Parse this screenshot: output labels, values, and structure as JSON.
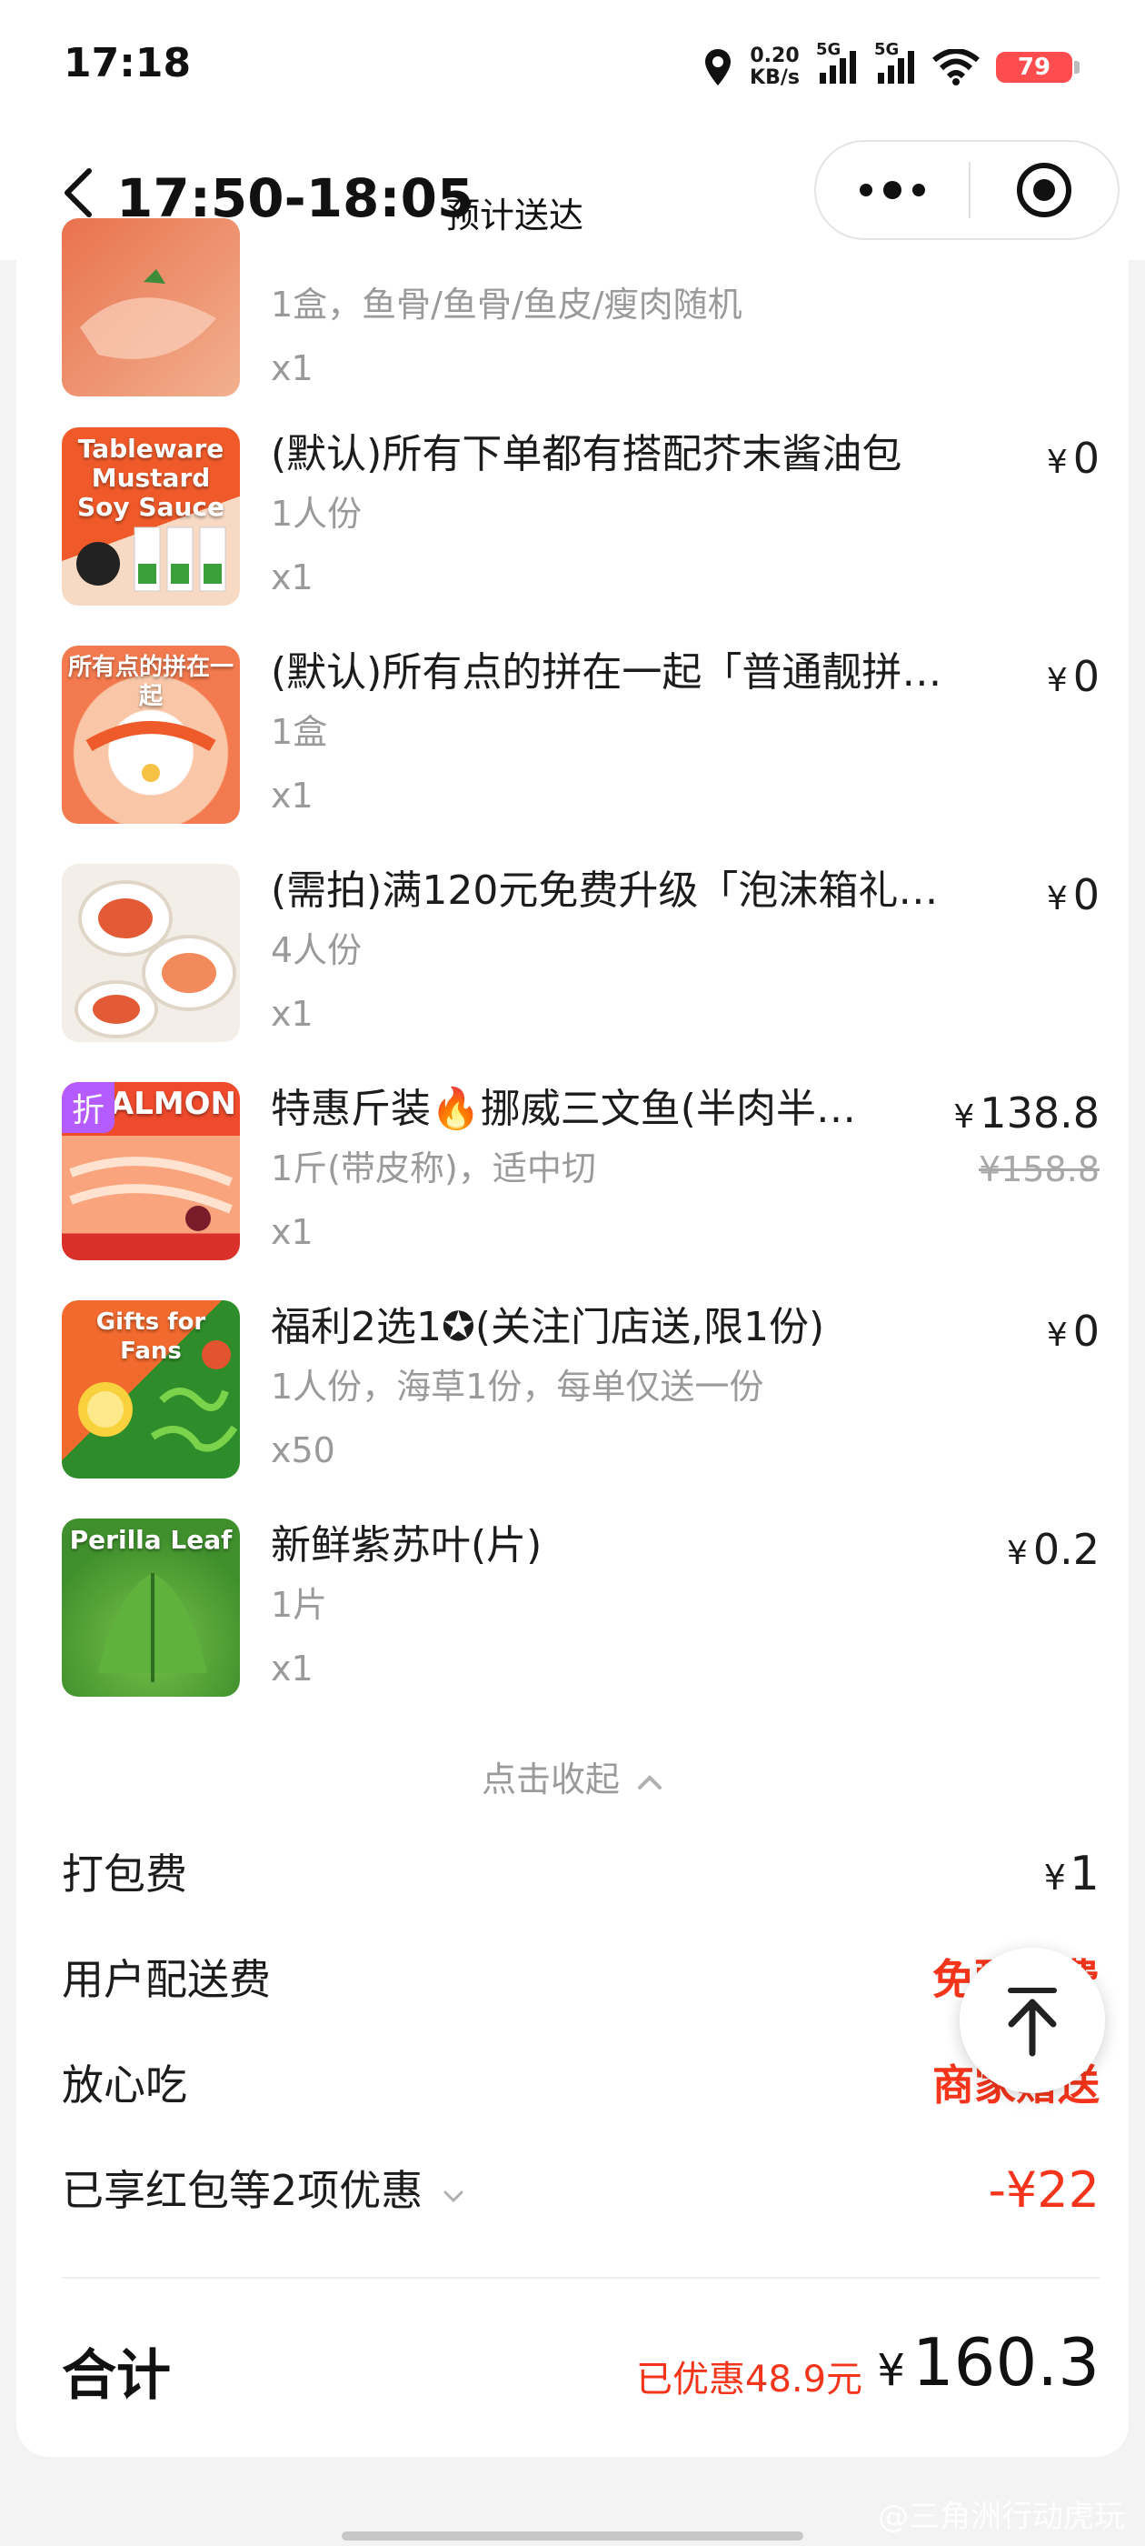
{
  "status_bar": {
    "time": "17:18",
    "net_speed_value": "0.20",
    "net_speed_unit": "KB/s",
    "signal_1": "5G",
    "signal_2": "5G",
    "battery": "79"
  },
  "header": {
    "delivery_time": "17:50-18:05",
    "delivery_label": "预计送达"
  },
  "items": [
    {
      "name": "",
      "spec": "1盒，鱼骨/鱼骨/鱼皮/瘦肉随机",
      "qty": "x1",
      "price": "",
      "image_colors": [
        "#e9724d",
        "#f2b08f"
      ]
    },
    {
      "name": "(默认)所有下单都有搭配芥末酱油包",
      "spec": "1人份",
      "qty": "x1",
      "price": "0",
      "image_text": "Tableware Mustard Soy Sauce",
      "image_colors": [
        "#f05a2a",
        "#f7d9c4"
      ]
    },
    {
      "name": "(默认)所有点的拼在一起「普通靓拼…",
      "spec": "1盒",
      "qty": "x1",
      "price": "0",
      "image_text": "所有点的拼在一起",
      "image_colors": [
        "#f37a4e",
        "#f9c7a8"
      ]
    },
    {
      "name": "(需拍)满120元免费升级「泡沫箱礼…",
      "spec": "4人份",
      "qty": "x1",
      "price": "0",
      "image_colors": [
        "#f3efe8",
        "#e25a36"
      ]
    },
    {
      "name": "特惠斤装🔥挪威三文鱼(半肉半…",
      "spec": "1斤(带皮称)，适中切",
      "qty": "x1",
      "price": "138.8",
      "original_price": "¥158.8",
      "discount_tag": "折",
      "image_text": "ALMON",
      "image_colors": [
        "#ef4a2c",
        "#f9a47c"
      ]
    },
    {
      "name": "福利2选1✪(关注门店送,限1份)",
      "spec": "1人份，海草1份，每单仅送一份",
      "qty": "x50",
      "price": "0",
      "image_text": "Gifts for Fans",
      "image_colors": [
        "#f26a2e",
        "#2f8c2a"
      ]
    },
    {
      "name": "新鲜紫苏叶(片)",
      "spec": "1片",
      "qty": "x1",
      "price": "0.2",
      "image_text": "Perilla Leaf",
      "image_colors": [
        "#3f8f2c",
        "#77c24a"
      ]
    }
  ],
  "collapse_label": "点击收起",
  "fees": {
    "packing_label": "打包费",
    "packing_value": "1",
    "delivery_label": "用户配送费",
    "delivery_value": "免配送费",
    "assurance_label": "放心吃",
    "assurance_value": "商家赠送",
    "coupon_label": "已享红包等2项优惠",
    "coupon_value": "-¥22"
  },
  "total": {
    "label": "合计",
    "saved": "已优惠48.9元",
    "amount": "160.3"
  },
  "currency": "¥",
  "watermark": "@三角洲行动虎玩",
  "colors": {
    "accent_red": "#f5351b",
    "muted_text": "#9a9a9a",
    "discount_purple": "#b45cff"
  }
}
